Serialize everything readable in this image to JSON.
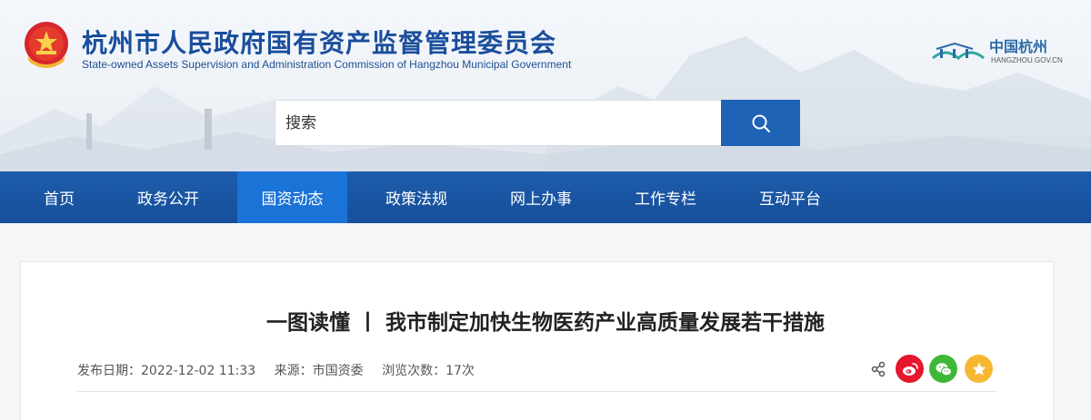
{
  "header": {
    "title": "杭州市人民政府国有资产监督管理委员会",
    "subtitle": "State-owned  Assets Supervision and Administration Commission of Hangzhou Municipal  Government",
    "city_logo_name": "中国杭州",
    "city_logo_url": "HANGZHOU.GOV.CN"
  },
  "search": {
    "placeholder": "搜索"
  },
  "nav": {
    "items": [
      {
        "label": "首页"
      },
      {
        "label": "政务公开"
      },
      {
        "label": "国资动态",
        "active": true
      },
      {
        "label": "政策法规"
      },
      {
        "label": "网上办事"
      },
      {
        "label": "工作专栏"
      },
      {
        "label": "互动平台"
      }
    ]
  },
  "article": {
    "title": "一图读懂 丨 我市制定加快生物医药产业高质量发展若干措施",
    "date": "发布日期：2022-12-02 11:33",
    "source": "来源：市国资委",
    "views": "浏览次数：17次"
  },
  "icons": {
    "search": "search-icon",
    "share": "share-icon",
    "weibo": "weibo-icon",
    "wechat": "wechat-icon",
    "favorite": "star-icon"
  },
  "colors": {
    "brand_blue": "#1f63b7",
    "nav_active": "#1a73d6",
    "weibo": "#e6162d",
    "wechat": "#3fb838",
    "favorite": "#f7b731"
  }
}
